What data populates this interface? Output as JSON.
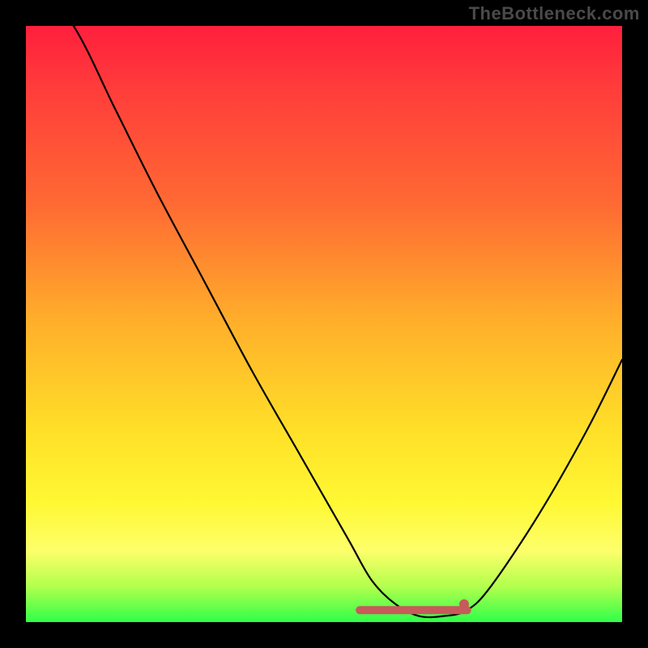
{
  "watermark": "TheBottleneck.com",
  "chart_data": {
    "type": "line",
    "title": "",
    "xlabel": "",
    "ylabel": "",
    "xlim": [
      0,
      100
    ],
    "ylim": [
      0,
      100
    ],
    "series": [
      {
        "name": "bottleneck-curve",
        "x": [
          0,
          8,
          15,
          22,
          30,
          38,
          46,
          54,
          58,
          62,
          66,
          70,
          74,
          78,
          86,
          94,
          100
        ],
        "values": [
          110,
          100,
          86,
          72,
          57,
          42,
          28,
          14,
          7,
          3,
          1,
          1,
          2,
          6,
          18,
          32,
          44
        ]
      }
    ],
    "flat_region": {
      "x_start": 56,
      "x_end": 74,
      "y": 2,
      "color": "#c75a5a",
      "dot_x": 73.5,
      "dot_y": 3
    },
    "gradient_stops": [
      {
        "pos": 0,
        "color": "#ff1f3d"
      },
      {
        "pos": 10,
        "color": "#ff3b3b"
      },
      {
        "pos": 30,
        "color": "#ff6a33"
      },
      {
        "pos": 50,
        "color": "#ffb02a"
      },
      {
        "pos": 68,
        "color": "#ffe028"
      },
      {
        "pos": 80,
        "color": "#fff833"
      },
      {
        "pos": 88,
        "color": "#fdff6a"
      },
      {
        "pos": 94,
        "color": "#b3ff4d"
      },
      {
        "pos": 100,
        "color": "#2eff4a"
      }
    ]
  }
}
